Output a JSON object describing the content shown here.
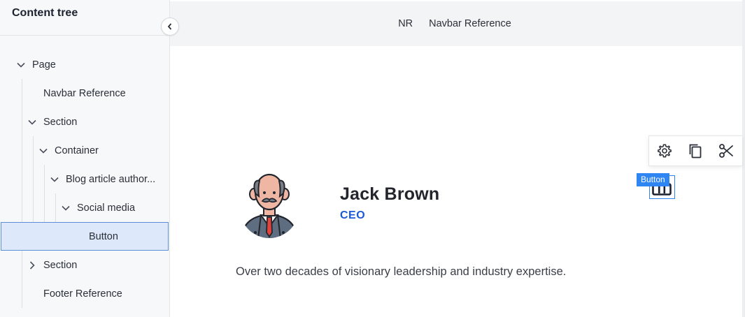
{
  "sidebar": {
    "title": "Content tree",
    "items": [
      {
        "label": "Page"
      },
      {
        "label": "Navbar Reference"
      },
      {
        "label": "Section"
      },
      {
        "label": "Container"
      },
      {
        "label": "Blog article author..."
      },
      {
        "label": "Social media"
      },
      {
        "label": "Button"
      },
      {
        "label": "Section"
      },
      {
        "label": "Footer Reference"
      }
    ]
  },
  "navbar": {
    "initials": "NR",
    "title": "Navbar Reference"
  },
  "author": {
    "name": "Jack Brown",
    "role": "CEO",
    "bio": "Over two decades of visionary leadership and industry expertise."
  },
  "selection": {
    "badge": "Button"
  },
  "colors": {
    "accent": "#2f86f2",
    "role_text": "#1a5ad7",
    "selected_row_bg": "#dde9fb"
  },
  "icons": [
    "chevron-left-icon",
    "chevron-down-icon",
    "chevron-right-icon",
    "gear-icon",
    "copy-icon",
    "scissors-icon",
    "social-icon"
  ]
}
